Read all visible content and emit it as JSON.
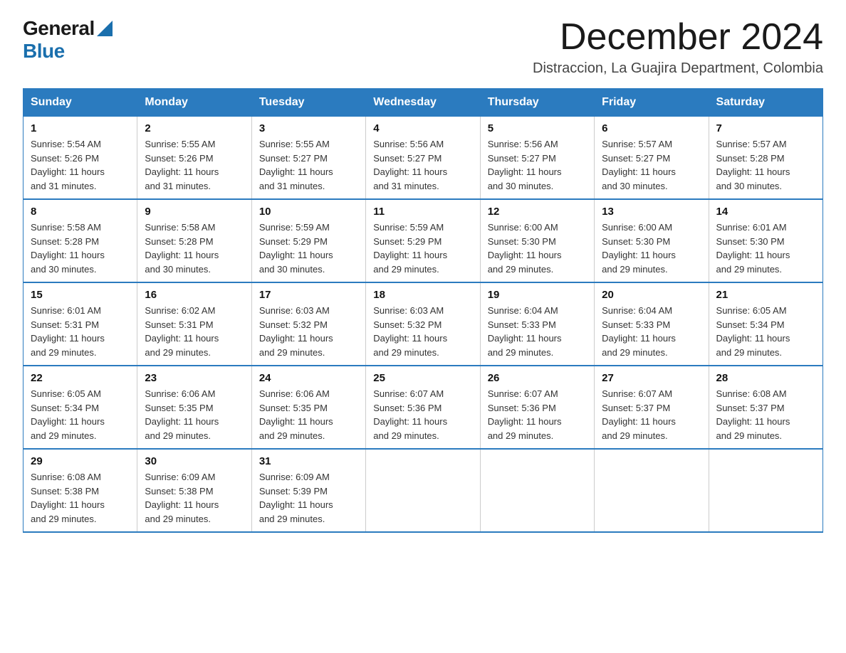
{
  "logo": {
    "general": "General",
    "blue": "Blue"
  },
  "title": {
    "month": "December 2024",
    "location": "Distraccion, La Guajira Department, Colombia"
  },
  "days_of_week": [
    "Sunday",
    "Monday",
    "Tuesday",
    "Wednesday",
    "Thursday",
    "Friday",
    "Saturday"
  ],
  "weeks": [
    [
      {
        "day": "1",
        "info": "Sunrise: 5:54 AM\nSunset: 5:26 PM\nDaylight: 11 hours\nand 31 minutes."
      },
      {
        "day": "2",
        "info": "Sunrise: 5:55 AM\nSunset: 5:26 PM\nDaylight: 11 hours\nand 31 minutes."
      },
      {
        "day": "3",
        "info": "Sunrise: 5:55 AM\nSunset: 5:27 PM\nDaylight: 11 hours\nand 31 minutes."
      },
      {
        "day": "4",
        "info": "Sunrise: 5:56 AM\nSunset: 5:27 PM\nDaylight: 11 hours\nand 31 minutes."
      },
      {
        "day": "5",
        "info": "Sunrise: 5:56 AM\nSunset: 5:27 PM\nDaylight: 11 hours\nand 30 minutes."
      },
      {
        "day": "6",
        "info": "Sunrise: 5:57 AM\nSunset: 5:27 PM\nDaylight: 11 hours\nand 30 minutes."
      },
      {
        "day": "7",
        "info": "Sunrise: 5:57 AM\nSunset: 5:28 PM\nDaylight: 11 hours\nand 30 minutes."
      }
    ],
    [
      {
        "day": "8",
        "info": "Sunrise: 5:58 AM\nSunset: 5:28 PM\nDaylight: 11 hours\nand 30 minutes."
      },
      {
        "day": "9",
        "info": "Sunrise: 5:58 AM\nSunset: 5:28 PM\nDaylight: 11 hours\nand 30 minutes."
      },
      {
        "day": "10",
        "info": "Sunrise: 5:59 AM\nSunset: 5:29 PM\nDaylight: 11 hours\nand 30 minutes."
      },
      {
        "day": "11",
        "info": "Sunrise: 5:59 AM\nSunset: 5:29 PM\nDaylight: 11 hours\nand 29 minutes."
      },
      {
        "day": "12",
        "info": "Sunrise: 6:00 AM\nSunset: 5:30 PM\nDaylight: 11 hours\nand 29 minutes."
      },
      {
        "day": "13",
        "info": "Sunrise: 6:00 AM\nSunset: 5:30 PM\nDaylight: 11 hours\nand 29 minutes."
      },
      {
        "day": "14",
        "info": "Sunrise: 6:01 AM\nSunset: 5:30 PM\nDaylight: 11 hours\nand 29 minutes."
      }
    ],
    [
      {
        "day": "15",
        "info": "Sunrise: 6:01 AM\nSunset: 5:31 PM\nDaylight: 11 hours\nand 29 minutes."
      },
      {
        "day": "16",
        "info": "Sunrise: 6:02 AM\nSunset: 5:31 PM\nDaylight: 11 hours\nand 29 minutes."
      },
      {
        "day": "17",
        "info": "Sunrise: 6:03 AM\nSunset: 5:32 PM\nDaylight: 11 hours\nand 29 minutes."
      },
      {
        "day": "18",
        "info": "Sunrise: 6:03 AM\nSunset: 5:32 PM\nDaylight: 11 hours\nand 29 minutes."
      },
      {
        "day": "19",
        "info": "Sunrise: 6:04 AM\nSunset: 5:33 PM\nDaylight: 11 hours\nand 29 minutes."
      },
      {
        "day": "20",
        "info": "Sunrise: 6:04 AM\nSunset: 5:33 PM\nDaylight: 11 hours\nand 29 minutes."
      },
      {
        "day": "21",
        "info": "Sunrise: 6:05 AM\nSunset: 5:34 PM\nDaylight: 11 hours\nand 29 minutes."
      }
    ],
    [
      {
        "day": "22",
        "info": "Sunrise: 6:05 AM\nSunset: 5:34 PM\nDaylight: 11 hours\nand 29 minutes."
      },
      {
        "day": "23",
        "info": "Sunrise: 6:06 AM\nSunset: 5:35 PM\nDaylight: 11 hours\nand 29 minutes."
      },
      {
        "day": "24",
        "info": "Sunrise: 6:06 AM\nSunset: 5:35 PM\nDaylight: 11 hours\nand 29 minutes."
      },
      {
        "day": "25",
        "info": "Sunrise: 6:07 AM\nSunset: 5:36 PM\nDaylight: 11 hours\nand 29 minutes."
      },
      {
        "day": "26",
        "info": "Sunrise: 6:07 AM\nSunset: 5:36 PM\nDaylight: 11 hours\nand 29 minutes."
      },
      {
        "day": "27",
        "info": "Sunrise: 6:07 AM\nSunset: 5:37 PM\nDaylight: 11 hours\nand 29 minutes."
      },
      {
        "day": "28",
        "info": "Sunrise: 6:08 AM\nSunset: 5:37 PM\nDaylight: 11 hours\nand 29 minutes."
      }
    ],
    [
      {
        "day": "29",
        "info": "Sunrise: 6:08 AM\nSunset: 5:38 PM\nDaylight: 11 hours\nand 29 minutes."
      },
      {
        "day": "30",
        "info": "Sunrise: 6:09 AM\nSunset: 5:38 PM\nDaylight: 11 hours\nand 29 minutes."
      },
      {
        "day": "31",
        "info": "Sunrise: 6:09 AM\nSunset: 5:39 PM\nDaylight: 11 hours\nand 29 minutes."
      },
      {
        "day": "",
        "info": ""
      },
      {
        "day": "",
        "info": ""
      },
      {
        "day": "",
        "info": ""
      },
      {
        "day": "",
        "info": ""
      }
    ]
  ]
}
